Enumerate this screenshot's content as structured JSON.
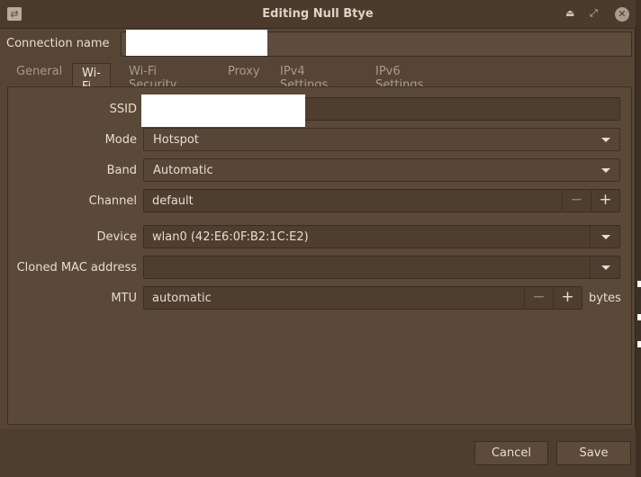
{
  "window": {
    "title": "Editing Null Btye"
  },
  "connection_name": {
    "label": "Connection name",
    "value": ""
  },
  "tabs": [
    {
      "label": "General"
    },
    {
      "label": "Wi-Fi",
      "active": true
    },
    {
      "label": "Wi-Fi Security"
    },
    {
      "label": "Proxy"
    },
    {
      "label": "IPv4 Settings"
    },
    {
      "label": "IPv6 Settings"
    }
  ],
  "wifi": {
    "ssid": {
      "label": "SSID",
      "value": ""
    },
    "mode": {
      "label": "Mode",
      "value": "Hotspot"
    },
    "band": {
      "label": "Band",
      "value": "Automatic"
    },
    "channel": {
      "label": "Channel",
      "value": "default"
    },
    "device": {
      "label": "Device",
      "value": "wlan0 (42:E6:0F:B2:1C:E2)"
    },
    "cloned_mac": {
      "label": "Cloned MAC address",
      "value": ""
    },
    "mtu": {
      "label": "MTU",
      "value": "automatic",
      "unit": "bytes"
    }
  },
  "stepper": {
    "minus": "−",
    "plus": "+"
  },
  "buttons": {
    "cancel": "Cancel",
    "save": "Save"
  }
}
